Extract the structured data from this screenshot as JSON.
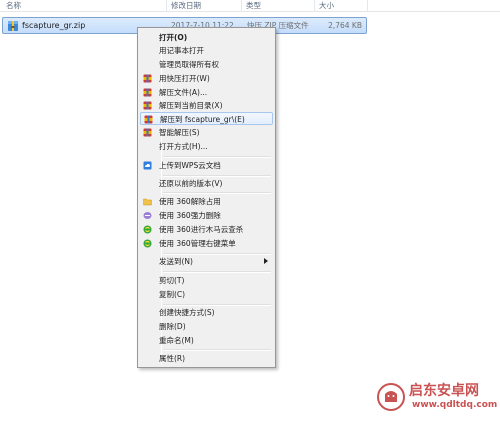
{
  "header": {
    "name": "名称",
    "date": "修改日期",
    "type": "类型",
    "size": "大小"
  },
  "file": {
    "name": "fscapture_gr.zip",
    "date": "2017-7-10 11:22",
    "type": "快压 ZIP 压缩文件",
    "size": "2,764 KB",
    "icon": "zip-archive-icon"
  },
  "menu": {
    "items": [
      {
        "label": "打开(O)",
        "icon": ""
      },
      {
        "label": "用记事本打开",
        "icon": ""
      },
      {
        "label": "管理员取得所有权",
        "icon": ""
      },
      {
        "label": "用快压打开(W)",
        "icon": "kuaiya-icon"
      },
      {
        "label": "解压文件(A)...",
        "icon": "kuaiya-icon"
      },
      {
        "label": "解压到当前目录(X)",
        "icon": "kuaiya-icon"
      },
      {
        "label": "解压到 fscapture_gr\\(E)",
        "icon": "kuaiya-icon"
      },
      {
        "label": "智能解压(S)",
        "icon": "kuaiya-icon"
      },
      {
        "label": "打开方式(H)...",
        "icon": ""
      },
      {
        "label": "上传到WPS云文档",
        "icon": "wps-cloud-icon"
      },
      {
        "label": "还原以前的版本(V)",
        "icon": ""
      },
      {
        "label": "使用 360解除占用",
        "icon": "folder-unlock-icon"
      },
      {
        "label": "使用 360强力删除",
        "icon": "shred-icon"
      },
      {
        "label": "使用 360进行木马云查杀",
        "icon": "360-shield-icon"
      },
      {
        "label": "使用 360管理右键菜单",
        "icon": "360-shield-icon"
      },
      {
        "label": "发送到(N)",
        "icon": ""
      },
      {
        "label": "剪切(T)",
        "icon": ""
      },
      {
        "label": "复制(C)",
        "icon": ""
      },
      {
        "label": "创建快捷方式(S)",
        "icon": ""
      },
      {
        "label": "删除(D)",
        "icon": ""
      },
      {
        "label": "重命名(M)",
        "icon": ""
      },
      {
        "label": "属性(R)",
        "icon": ""
      }
    ]
  },
  "watermark": {
    "title": "启东安卓网",
    "url": "www.qdltdq.com"
  },
  "colors": {
    "selection_fill": "#c4ddfb",
    "selection_border": "#7da2ce",
    "menu_bg": "#f0f0f0",
    "menu_hover_border": "#a8c7ef",
    "watermark": "#c95353"
  }
}
